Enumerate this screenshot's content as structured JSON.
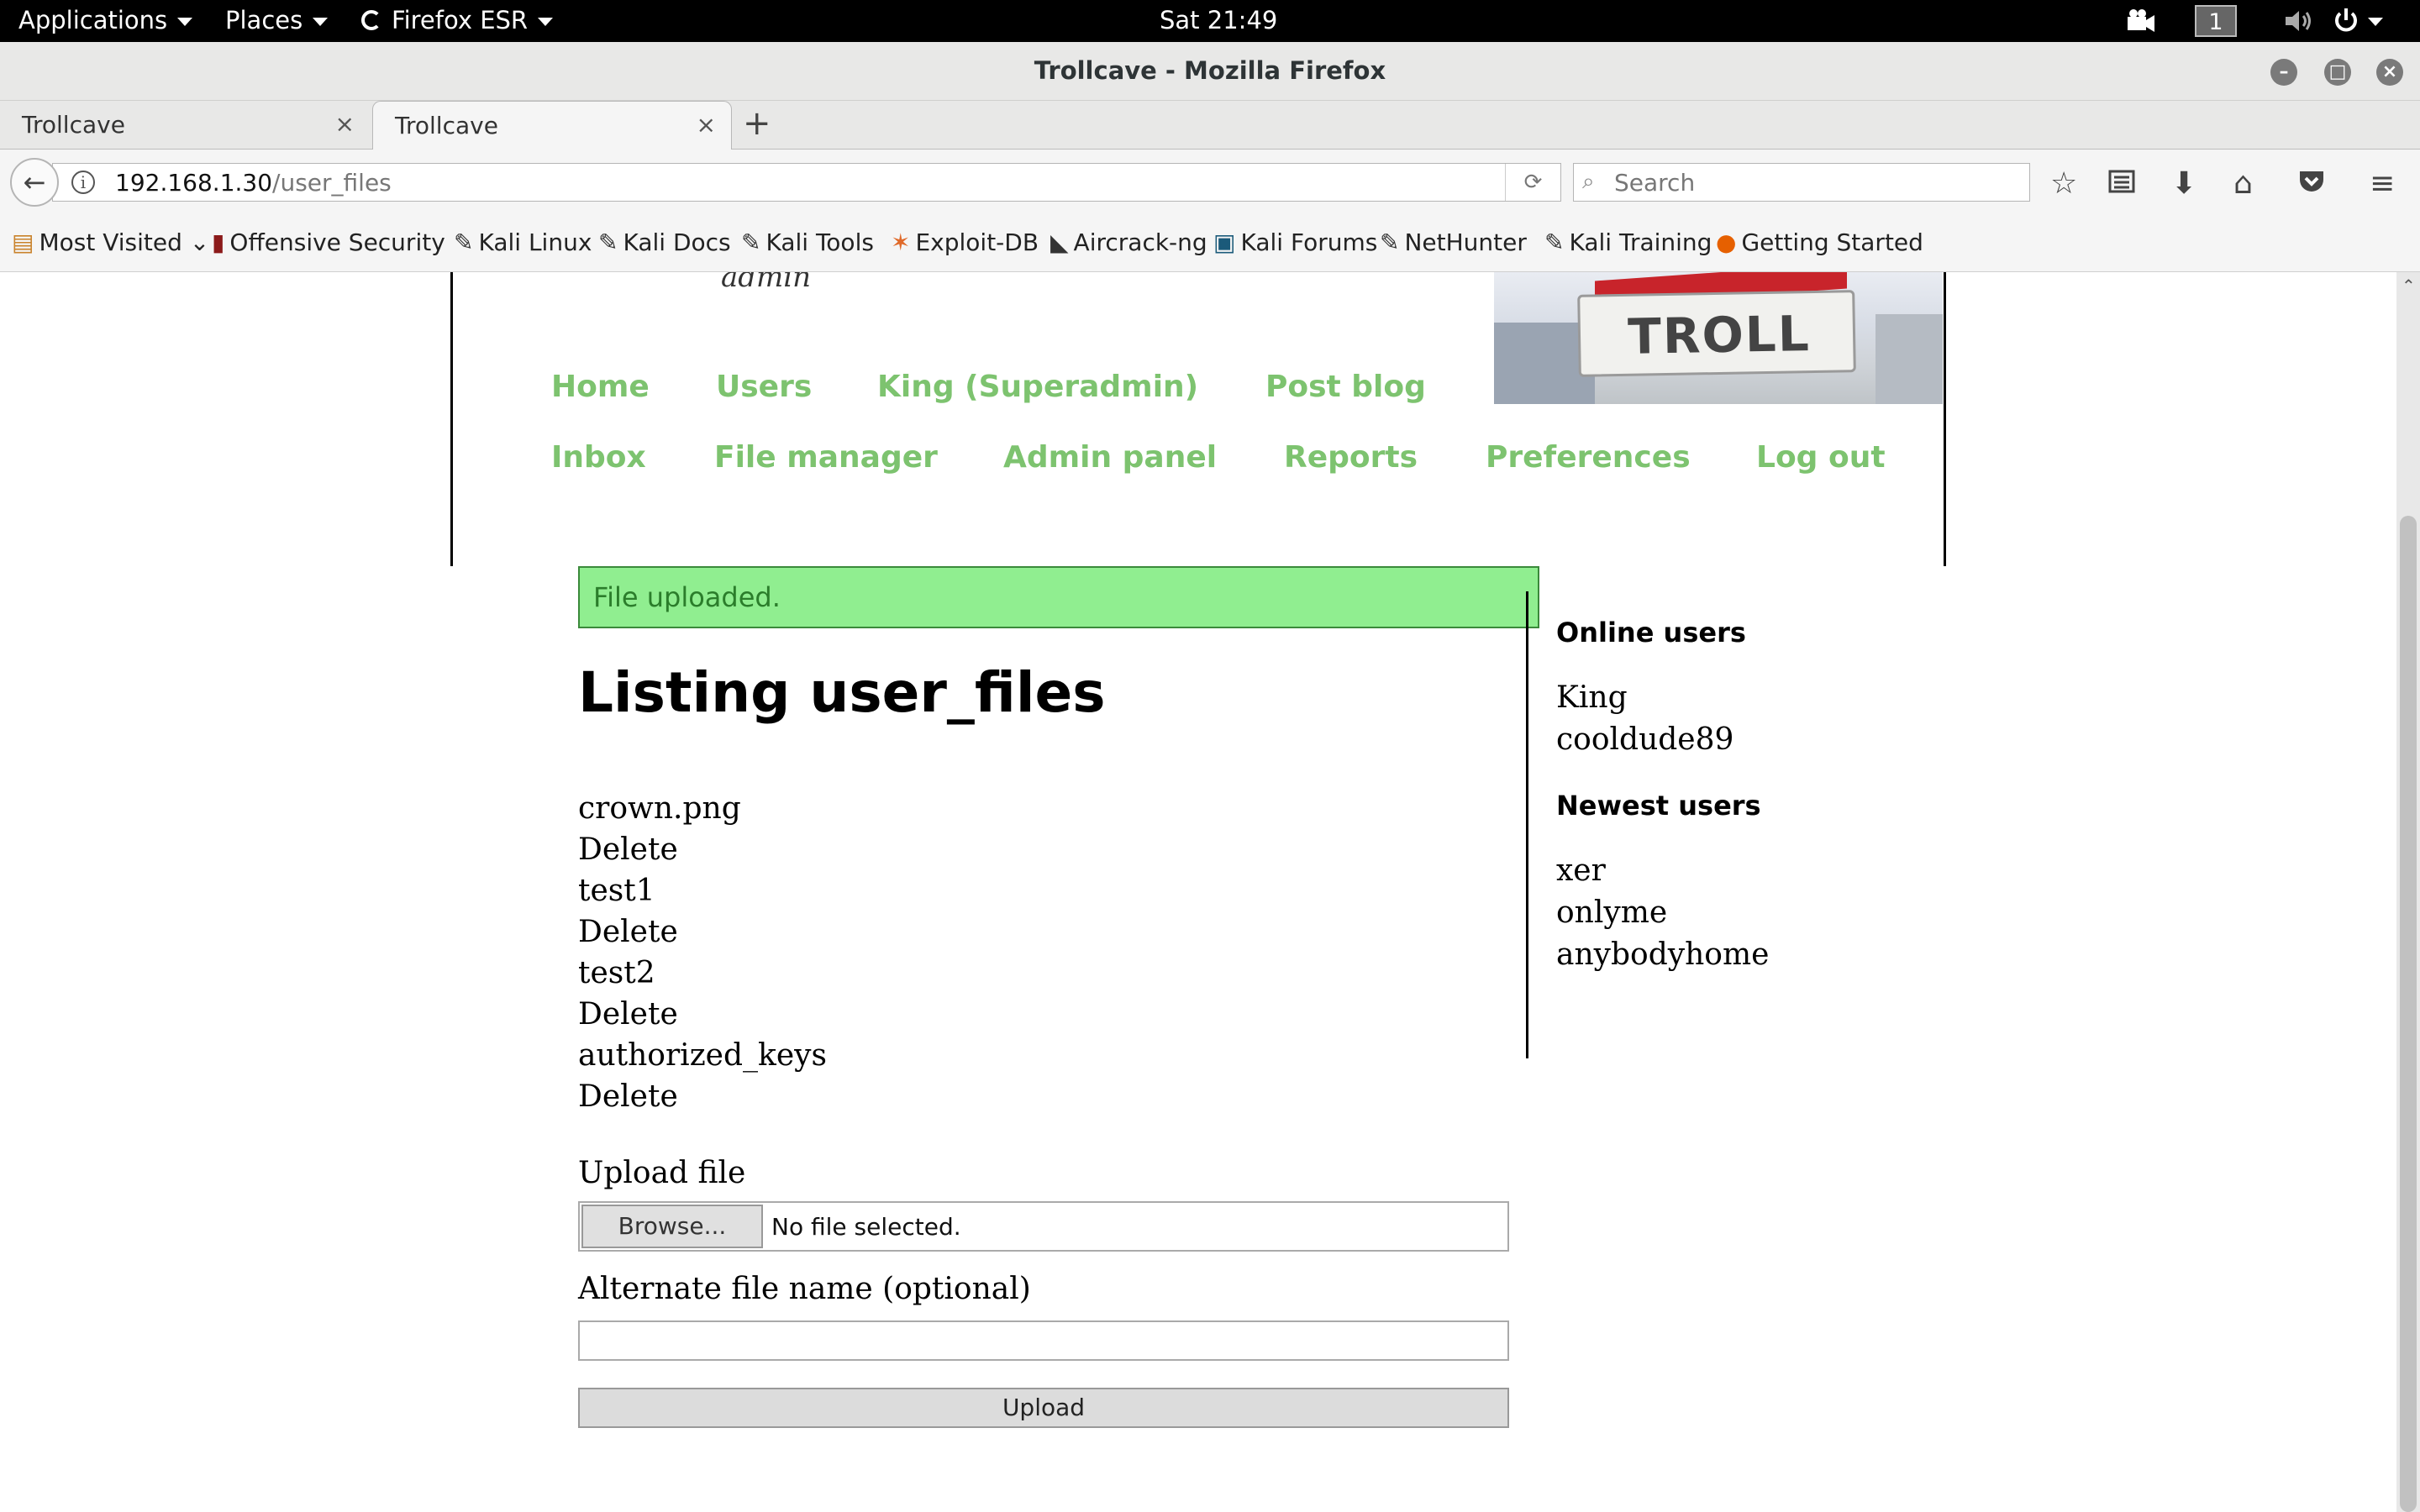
{
  "topbar": {
    "applications": "Applications",
    "places": "Places",
    "firefox": "Firefox ESR",
    "clock": "Sat 21:49",
    "workspace": "1"
  },
  "window": {
    "title": "Trollcave - Mozilla Firefox"
  },
  "tabs": [
    {
      "label": "Trollcave",
      "active": false
    },
    {
      "label": "Trollcave",
      "active": true
    }
  ],
  "address": {
    "host": "192.168.1.30",
    "path": "/user_files",
    "search_placeholder": "Search"
  },
  "bookmarks": [
    {
      "label": "Most Visited",
      "icon": "folder-icon"
    },
    {
      "label": "Offensive Security",
      "icon": "offsec-icon"
    },
    {
      "label": "Kali Linux",
      "icon": "kali-icon"
    },
    {
      "label": "Kali Docs",
      "icon": "kali-icon"
    },
    {
      "label": "Kali Tools",
      "icon": "kali-icon"
    },
    {
      "label": "Exploit-DB",
      "icon": "exploitdb-icon"
    },
    {
      "label": "Aircrack-ng",
      "icon": "aircrack-icon"
    },
    {
      "label": "Kali Forums",
      "icon": "forums-icon"
    },
    {
      "label": "NetHunter",
      "icon": "kali-icon"
    },
    {
      "label": "Kali Training",
      "icon": "kali-icon"
    },
    {
      "label": "Getting Started",
      "icon": "firefox-icon"
    }
  ],
  "page": {
    "role": "admin",
    "banner_sign": "TROLL",
    "nav": {
      "home": "Home",
      "users": "Users",
      "king": "King (Superadmin)",
      "post_blog": "Post blog",
      "inbox": "Inbox",
      "file_manager": "File manager",
      "admin_panel": "Admin panel",
      "reports": "Reports",
      "preferences": "Preferences",
      "logout": "Log out"
    },
    "flash": "File uploaded.",
    "title": "Listing user_files",
    "files": [
      {
        "name": "crown.png",
        "action": "Delete"
      },
      {
        "name": "test1",
        "action": "Delete"
      },
      {
        "name": "test2",
        "action": "Delete"
      },
      {
        "name": "authorized_keys",
        "action": "Delete"
      }
    ],
    "upload": {
      "label": "Upload file",
      "browse": "Browse...",
      "no_file": "No file selected.",
      "alt_label": "Alternate file name (optional)",
      "alt_value": "",
      "submit": "Upload"
    },
    "sidebar": {
      "online_heading": "Online users",
      "online_users": [
        "King",
        "cooldude89"
      ],
      "newest_heading": "Newest users",
      "newest_users": [
        "xer",
        "onlyme",
        "anybodyhome"
      ]
    }
  },
  "colors": {
    "nav_link": "#7dc36f",
    "flash_bg": "#90ee90",
    "flash_text": "#2b7d2b"
  }
}
